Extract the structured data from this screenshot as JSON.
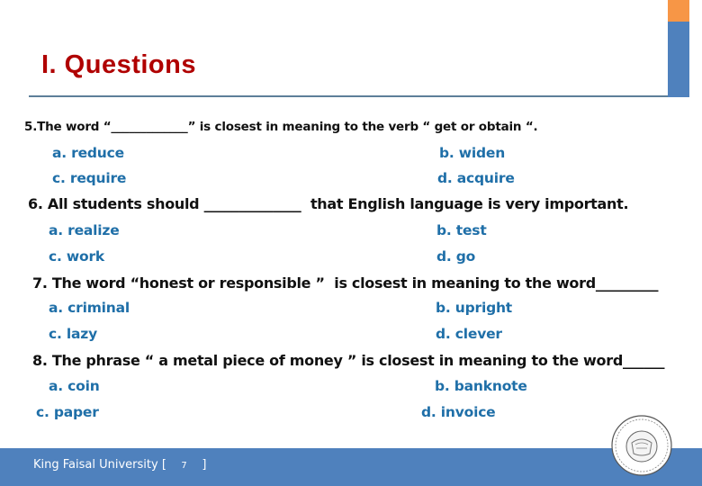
{
  "slide": {
    "title": "I. Questions",
    "colors": {
      "title": "#b00000",
      "option": "#1f6fa8",
      "accent_orange": "#f79646",
      "accent_blue": "#4f81bd"
    }
  },
  "questions": [
    {
      "text": "5.The word “_____________” is closest in meaning to the verb “ get or obtain “.",
      "options": [
        "a. reduce",
        "b. widen",
        "c. require",
        "d. acquire"
      ]
    },
    {
      "text": "6. All students should ______________  that English language is very important.",
      "options": [
        "a. realize",
        "b. test",
        "c. work",
        "d. go"
      ]
    },
    {
      "text": "7. The word “honest or responsible ”  is closest in meaning to the word_________",
      "options": [
        "a. criminal",
        "b. upright",
        "c. lazy",
        "d. clever"
      ]
    },
    {
      "text": "8. The phrase “ a metal piece of money ” is closest in meaning to the word______",
      "options": [
        "a. coin",
        "b. banknote",
        "c. paper",
        "d. invoice"
      ]
    }
  ],
  "footer": {
    "university": "King Faisal University [",
    "page_number": "7",
    "close_bracket": "]",
    "logo": "university-seal-icon"
  }
}
